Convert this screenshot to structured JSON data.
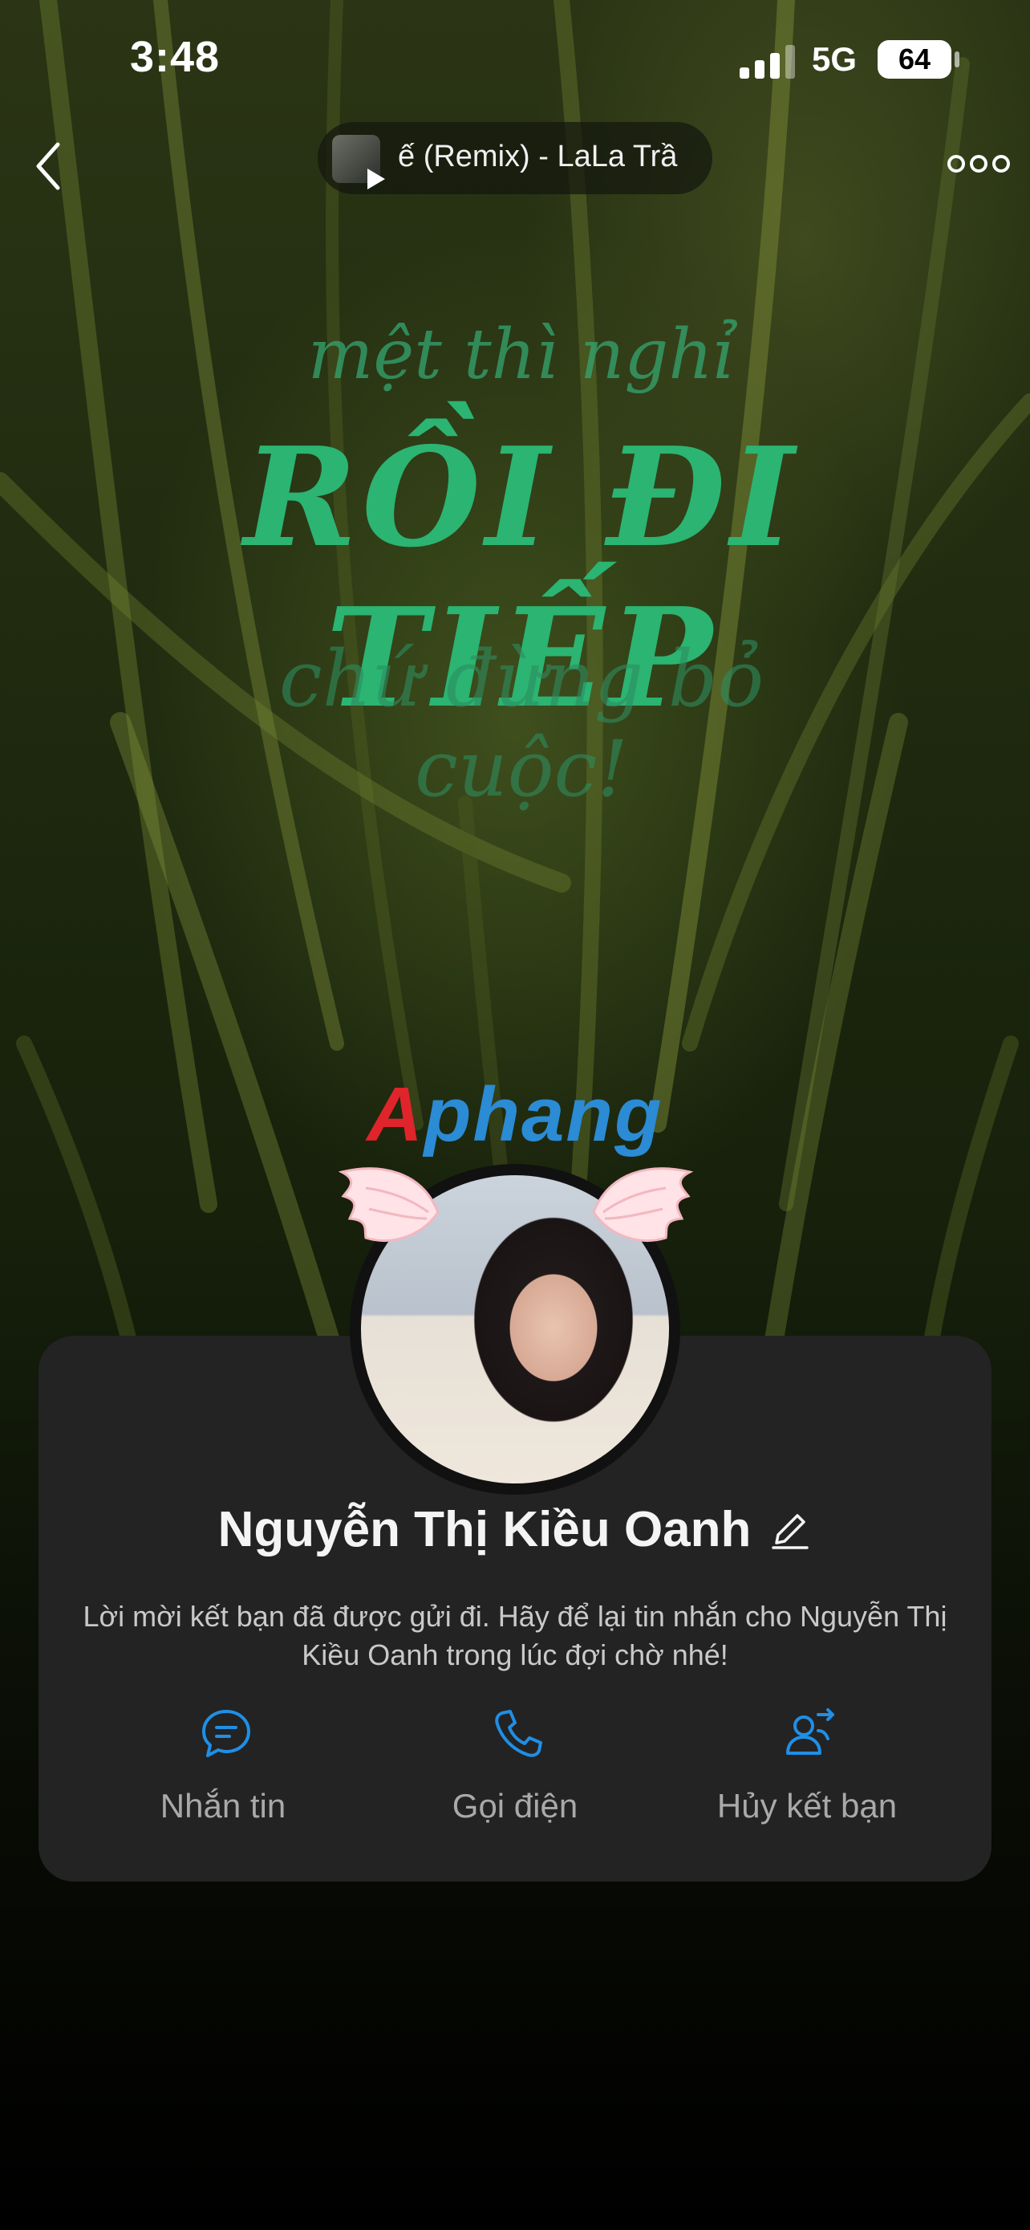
{
  "status_bar": {
    "time": "3:48",
    "network": "5G",
    "battery": "64"
  },
  "top_bar": {
    "back_icon": "chevron-left-icon",
    "music": {
      "title": "ế (Remix) - LaLa Trầ",
      "icon": "play-icon"
    },
    "more_icon": "more-horizontal-icon"
  },
  "cover": {
    "line1": "mệt thì nghỉ",
    "line2": "RỒI ĐI TIẾP",
    "line3": "chứ đừng bỏ cuộc!",
    "watermark": {
      "first": "A",
      "rest": "phang"
    }
  },
  "profile": {
    "name": "Nguyễn Thị Kiều Oanh",
    "edit_icon": "pencil-icon",
    "message": "Lời mời kết bạn đã được gửi đi. Hãy để lại tin nhắn cho Nguyễn Thị Kiều Oanh trong lúc đợi chờ nhé!",
    "actions": [
      {
        "label": "Nhắn tin",
        "icon": "chat-icon"
      },
      {
        "label": "Gọi điện",
        "icon": "phone-icon"
      },
      {
        "label": "Hủy kết bạn",
        "icon": "unfriend-icon"
      }
    ]
  },
  "colors": {
    "accent": "#1f8fe6",
    "card": "#232323",
    "quote_green": "#2bb472"
  }
}
